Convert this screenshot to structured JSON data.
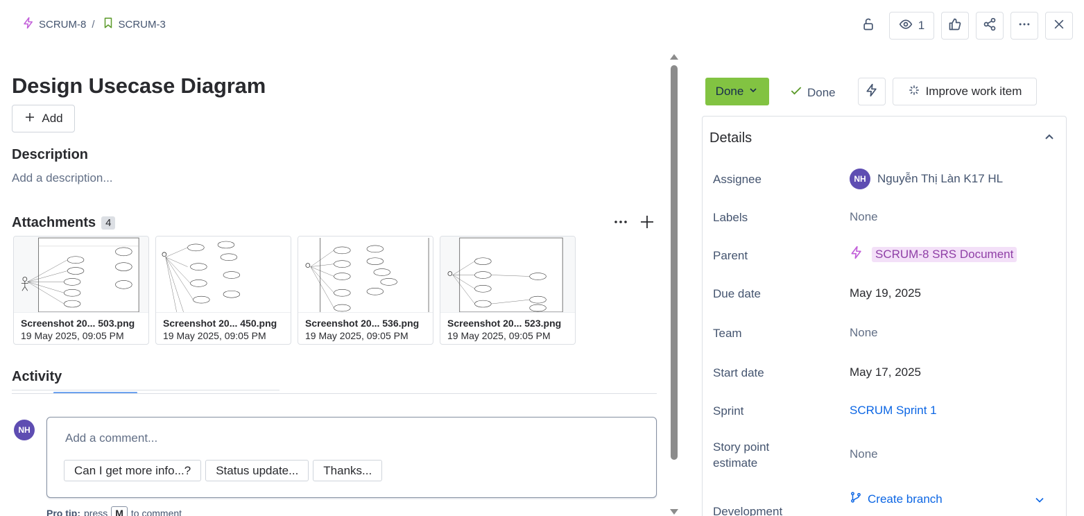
{
  "breadcrumb": {
    "parent_key": "SCRUM-8",
    "separator": "/",
    "current_key": "SCRUM-3"
  },
  "header": {
    "watchers_count": "1",
    "icons": [
      "lock-icon",
      "eye-icon",
      "thumbs-up-icon",
      "share-icon",
      "more-icon",
      "close-icon"
    ]
  },
  "issue": {
    "title": "Design Usecase Diagram",
    "add_label": "Add",
    "description_heading": "Description",
    "description_placeholder": "Add a description..."
  },
  "attachments": {
    "heading": "Attachments",
    "count": "4",
    "items": [
      {
        "name": "Screenshot 20...   503.png",
        "date": "19 May 2025, 09:05 PM"
      },
      {
        "name": "Screenshot 20...   450.png",
        "date": "19 May 2025, 09:05 PM"
      },
      {
        "name": "Screenshot 20...   536.png",
        "date": "19 May 2025, 09:05 PM"
      },
      {
        "name": "Screenshot 20...   523.png",
        "date": "19 May 2025, 09:05 PM"
      }
    ]
  },
  "activity": {
    "heading": "Activity",
    "user_initials": "NH",
    "comment_placeholder": "Add a comment...",
    "quick_replies": [
      "Can I get more info...?",
      "Status update...",
      "Thanks..."
    ],
    "pro_tip_label": "Pro tip:",
    "pro_tip_press": "press",
    "pro_tip_key": "M",
    "pro_tip_suffix": "to comment"
  },
  "status": {
    "current": "Done",
    "resolution": "Done",
    "improve_label": "Improve work item",
    "status_color": "#82c342"
  },
  "details": {
    "heading": "Details",
    "assignee_label": "Assignee",
    "assignee_initials": "NH",
    "assignee_name": "Nguyễn Thị Làn K17 HL",
    "labels_label": "Labels",
    "labels_value": "None",
    "parent_label": "Parent",
    "parent_value": "SCRUM-8 SRS Document",
    "due_label": "Due date",
    "due_value": "May 19, 2025",
    "team_label": "Team",
    "team_value": "None",
    "start_label": "Start date",
    "start_value": "May 17, 2025",
    "sprint_label": "Sprint",
    "sprint_value": "SCRUM Sprint 1",
    "story_label": "Story point estimate",
    "story_value": "None",
    "dev_label": "Development",
    "dev_value": "Create branch"
  }
}
